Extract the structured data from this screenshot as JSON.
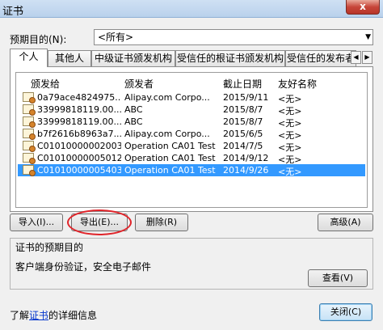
{
  "window": {
    "title": "证书",
    "close_label": "x"
  },
  "purpose": {
    "label": "预期目的(N):",
    "selected": "<所有>",
    "arrow": "▼"
  },
  "tabs": [
    {
      "label": "个人",
      "active": true
    },
    {
      "label": "其他人",
      "active": false
    },
    {
      "label": "中级证书颁发机构",
      "active": false
    },
    {
      "label": "受信任的根证书颁发机构",
      "active": false
    },
    {
      "label": "受信任的发布者",
      "active": false
    }
  ],
  "tab_scroll": {
    "left": "◀",
    "right": "▶"
  },
  "list": {
    "headers": {
      "issued_to": "颁发给",
      "issuer": "颁发者",
      "expiry": "截止日期",
      "friendly": "友好名称"
    },
    "rows": [
      {
        "issued_to": "0a79ace4824975...",
        "issuer": "Alipay.com Corpo...",
        "expiry": "2015/9/11",
        "friendly": "<无>",
        "selected": false
      },
      {
        "issued_to": "33999818119.00...",
        "issuer": "ABC",
        "expiry": "2015/8/7",
        "friendly": "<无>",
        "selected": false
      },
      {
        "issued_to": "33999818119.00...",
        "issuer": "ABC",
        "expiry": "2015/8/7",
        "friendly": "<无>",
        "selected": false
      },
      {
        "issued_to": "b7f2616b8963a7...",
        "issuer": "Alipay.com Corpo...",
        "expiry": "2015/6/5",
        "friendly": "<无>",
        "selected": false
      },
      {
        "issued_to": "C01010000002003",
        "issuer": "Operation CA01 Test",
        "expiry": "2014/7/5",
        "friendly": "<无>",
        "selected": false
      },
      {
        "issued_to": "C01010000005012",
        "issuer": "Operation CA01 Test",
        "expiry": "2014/9/12",
        "friendly": "<无>",
        "selected": false
      },
      {
        "issued_to": "C01010000005403",
        "issuer": "Operation CA01 Test",
        "expiry": "2014/9/26",
        "friendly": "<无>",
        "selected": true
      }
    ]
  },
  "buttons": {
    "import": "导入(I)...",
    "export": "导出(E)...",
    "remove": "删除(R)",
    "advanced": "高级(A)",
    "view": "查看(V)",
    "close": "关闭(C)"
  },
  "purposes_group": {
    "title": "证书的预期目的",
    "text": "客户端身份验证，安全电子邮件"
  },
  "details": {
    "prefix": "了解",
    "link": "证书",
    "suffix": "的详细信息"
  },
  "colors": {
    "selection": "#3399ff",
    "highlight_ellipse": "#e0242a"
  }
}
